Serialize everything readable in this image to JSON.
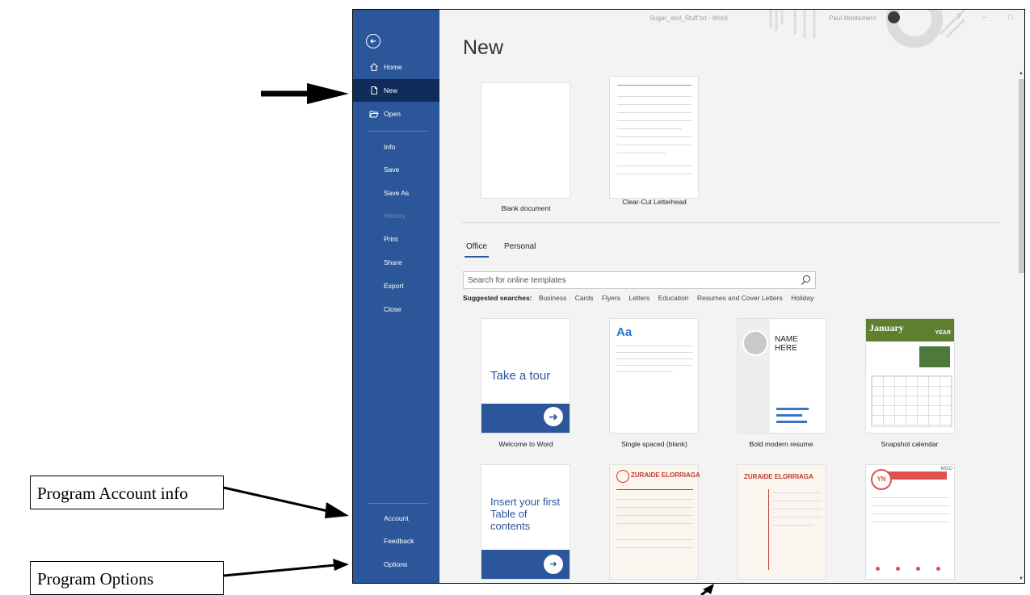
{
  "annotations": {
    "account_callout": "Program Account info",
    "options_callout": "Program Options"
  },
  "window": {
    "title": "Sugar_and_Stuff.txt  -  Word",
    "user_name": "Paul Montemero",
    "controls": [
      "?",
      "–",
      "□"
    ]
  },
  "sidebar": {
    "back_icon": "back-arrow-icon",
    "items": [
      {
        "label": "Home",
        "icon": "home-icon"
      },
      {
        "label": "New",
        "icon": "new-document-icon"
      },
      {
        "label": "Open",
        "icon": "folder-open-icon"
      },
      {
        "label": "Info"
      },
      {
        "label": "Save"
      },
      {
        "label": "Save As"
      },
      {
        "label": "History"
      },
      {
        "label": "Print"
      },
      {
        "label": "Share"
      },
      {
        "label": "Export"
      },
      {
        "label": "Close"
      },
      {
        "label": "Account"
      },
      {
        "label": "Feedback"
      },
      {
        "label": "Options"
      }
    ]
  },
  "main": {
    "title": "New",
    "featured": [
      {
        "label": "Blank document"
      },
      {
        "label": "Clear-Cut Letterhead"
      }
    ],
    "tabs": [
      "Office",
      "Personal"
    ],
    "search": {
      "placeholder": "Search for online templates"
    },
    "suggested_label": "Suggested searches:",
    "suggested": [
      "Business",
      "Cards",
      "Flyers",
      "Letters",
      "Education",
      "Resumes and Cover Letters",
      "Holiday"
    ],
    "templates": [
      {
        "label": "Welcome to Word",
        "thumb_text": "Take a tour"
      },
      {
        "label": "Single spaced (blank)",
        "thumb_text": "Aa"
      },
      {
        "label": "Bold modern resume",
        "thumb_text": "NAME HERE"
      },
      {
        "label": "Snapshot calendar",
        "thumb_text": "January",
        "thumb_sub": "YEAR"
      },
      {
        "label": "",
        "thumb_text": "Insert your first Table of contents"
      },
      {
        "label": "",
        "thumb_text": "ZURAIDE ELORRIAGA"
      },
      {
        "label": "",
        "thumb_text": "ZURAIDE ELORRIAGA"
      },
      {
        "label": "",
        "thumb_text": "YN",
        "thumb_badge": "MOO"
      }
    ]
  },
  "colors": {
    "sidebar": "#2b579a",
    "sidebar_active": "#0f2c5b",
    "accent_red": "#c0392b"
  }
}
